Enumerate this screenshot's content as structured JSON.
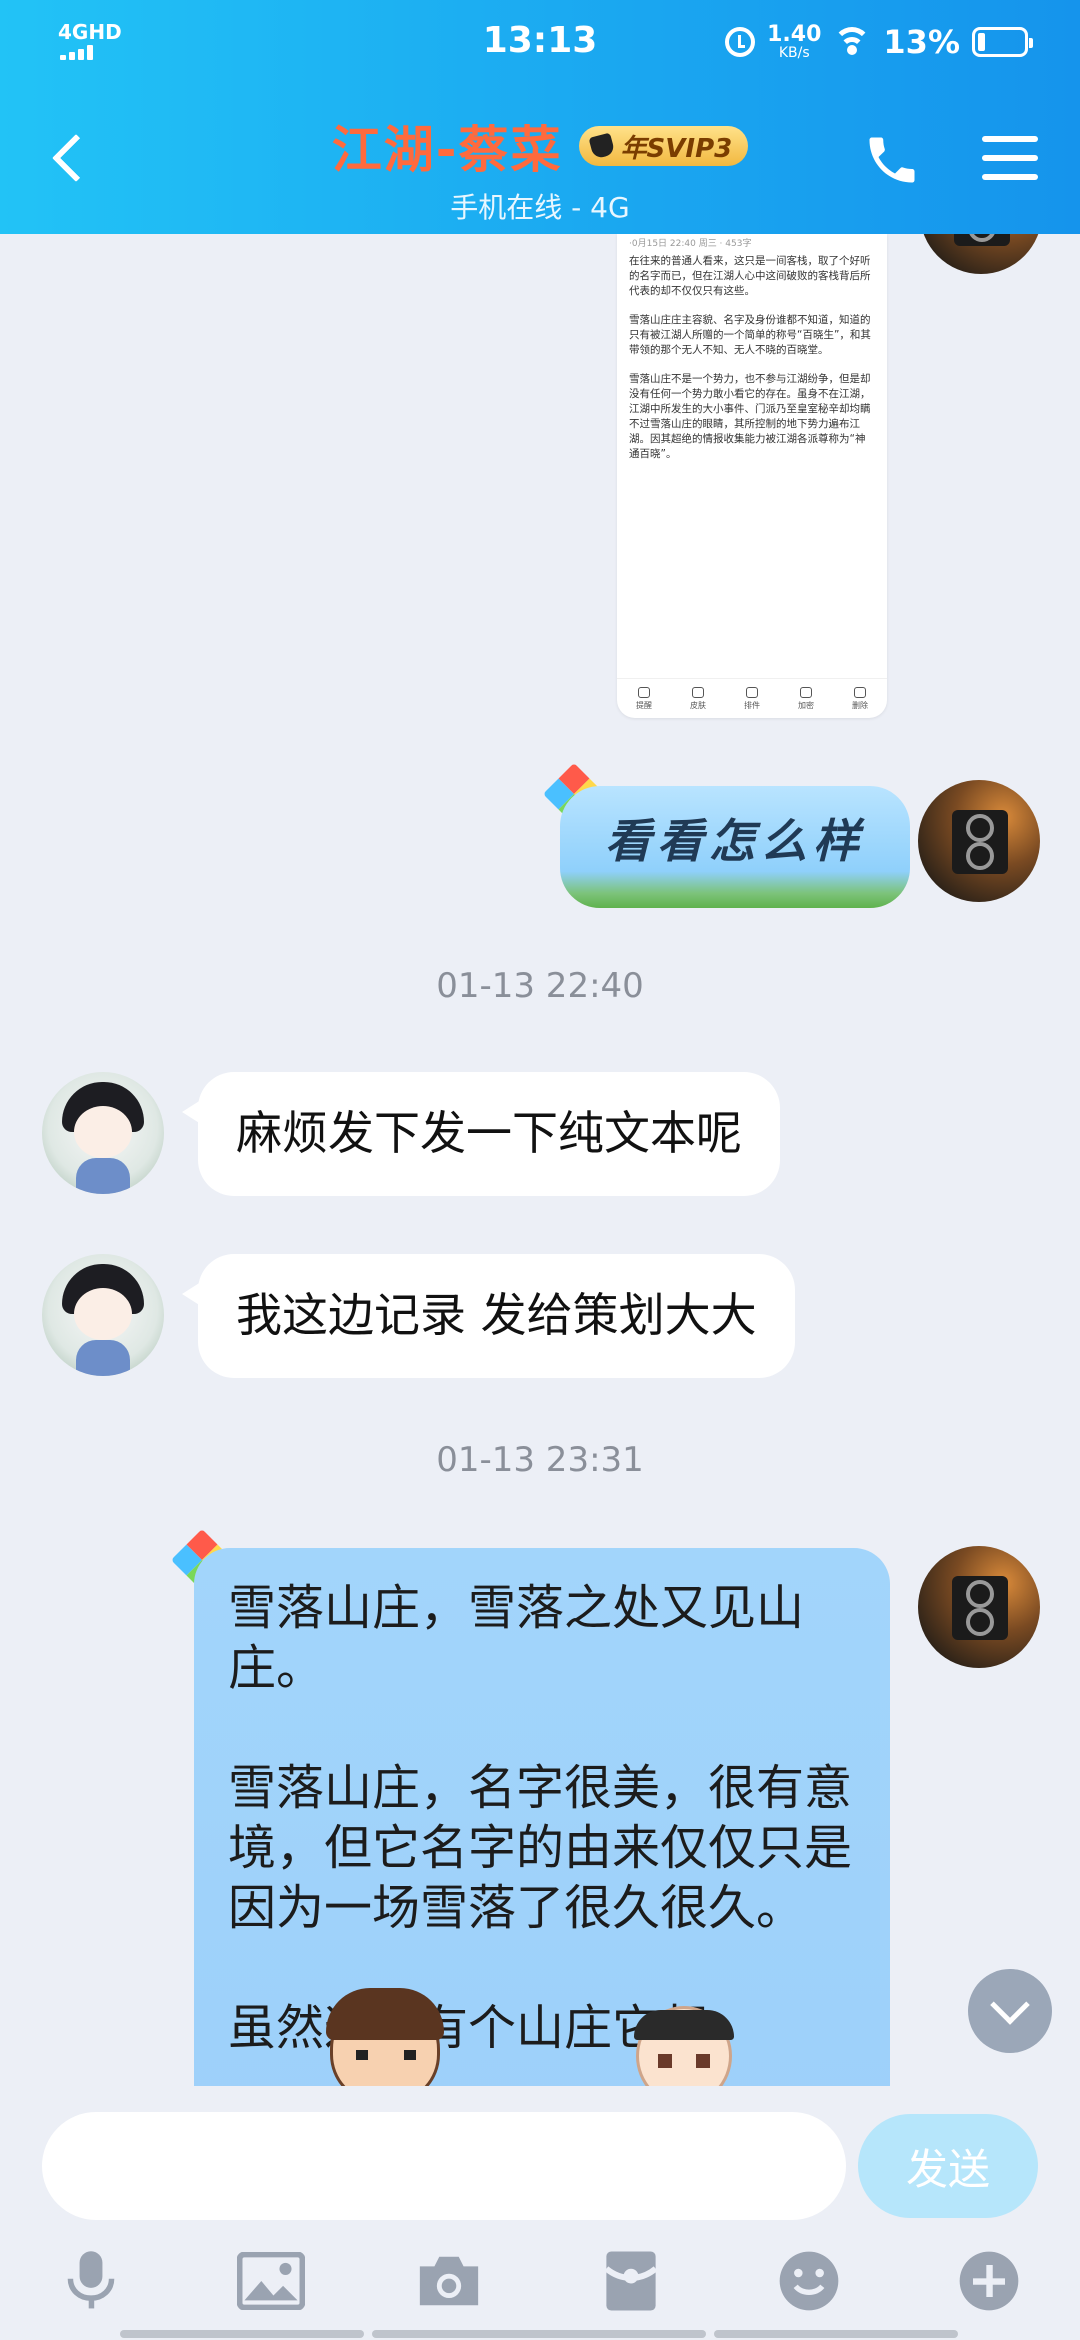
{
  "status_bar": {
    "network": "4GHD",
    "time": "13:13",
    "net_speed_value": "1.40",
    "net_speed_unit": "KB/s",
    "battery": "13%"
  },
  "header": {
    "contact_name": "江湖-蔡菜",
    "vip_badge": "年SVIP3",
    "status": "手机在线 - 4G"
  },
  "screenshot_card": {
    "header_snippet": "·0月15日 22:40 周三 · 453字",
    "paragraphs": [
      "在往来的普通人看来，这只是一间客栈，取了个好听的名字而已，但在江湖人心中这间破败的客栈背后所代表的却不仅仅只有这些。",
      "雪落山庄庄主容貌、名字及身份谁都不知道，知道的只有被江湖人所赠的一个简单的称号“百晓生”，和其带领的那个无人不知、无人不晓的百晓堂。",
      "雪落山庄不是一个势力，也不参与江湖纷争，但是却没有任何一个势力敢小看它的存在。虽身不在江湖，江湖中所发生的大小事件、门派乃至皇室秘辛却均瞒不过雪落山庄的眼睛，其所控制的地下势力遍布江湖。因其超绝的情报收集能力被江湖各派尊称为“神通百晓”。"
    ],
    "toolbar": [
      "提醒",
      "皮肤",
      "排件",
      "加密",
      "删除"
    ]
  },
  "messages": [
    {
      "side": "out",
      "style": "kite",
      "text": "看看怎么样"
    },
    {
      "type": "timestamp",
      "text": "01-13 22:40"
    },
    {
      "side": "in",
      "text": "麻烦发下发一下纯文本呢"
    },
    {
      "side": "in",
      "text": "我这边记录 发给策划大大"
    },
    {
      "type": "timestamp",
      "text": "01-13 23:31"
    },
    {
      "side": "out",
      "style": "long",
      "text": "雪落山庄，雪落之处又见山庄。\n\n雪落山庄，名字很美，很有意境，但它名字的由来仅仅只是因为一场雪落了很久很久。\n\n虽然这里有个山庄它却"
    }
  ],
  "input": {
    "placeholder": "",
    "send_label": "发送"
  },
  "toolbar_icons": [
    "microphone-icon",
    "image-icon",
    "camera-icon",
    "red-packet-icon",
    "emoji-icon",
    "plus-icon"
  ],
  "colors": {
    "header_start": "#22c3f6",
    "header_end": "#1594ec",
    "contact_name": "#ff6a3d",
    "background": "#eceff6",
    "outgoing_bubble": "#a2d5fb",
    "send_button": "#b6e6fb"
  }
}
